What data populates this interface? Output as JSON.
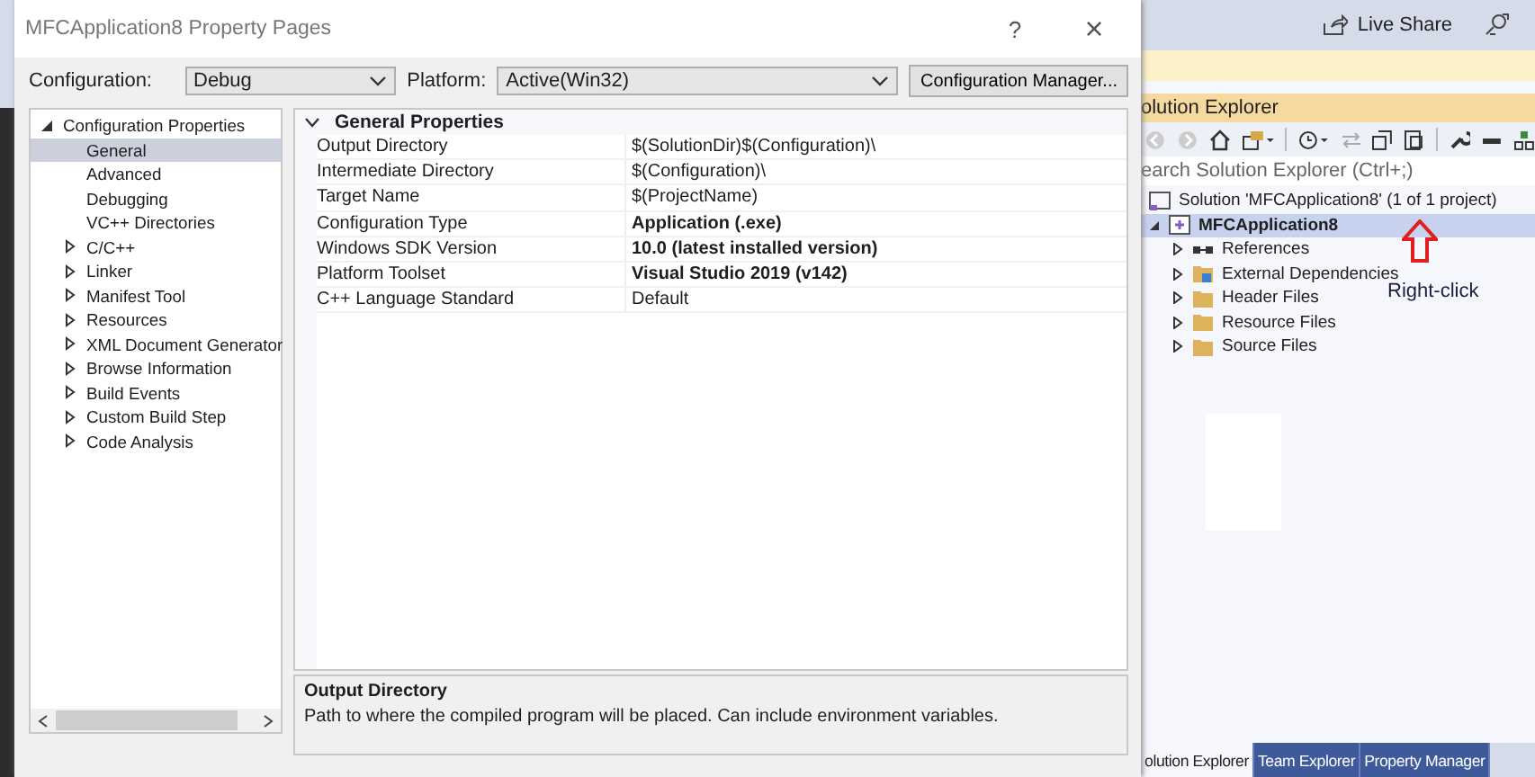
{
  "dialog": {
    "title": "MFCApplication8 Property Pages",
    "help": "?",
    "close": "×",
    "configuration": {
      "label": "Configuration:",
      "value": "Debug"
    },
    "platform": {
      "label": "Platform:",
      "value": "Active(Win32)"
    },
    "config_manager": "Configuration Manager...",
    "tree": [
      {
        "label": "Configuration Properties",
        "expanded": true,
        "selected": false,
        "children": [
          {
            "label": "General",
            "selected": true,
            "expandable": false
          },
          {
            "label": "Advanced",
            "selected": false,
            "expandable": false
          },
          {
            "label": "Debugging",
            "selected": false,
            "expandable": false
          },
          {
            "label": "VC++ Directories",
            "selected": false,
            "expandable": false
          },
          {
            "label": "C/C++",
            "selected": false,
            "expandable": true
          },
          {
            "label": "Linker",
            "selected": false,
            "expandable": true
          },
          {
            "label": "Manifest Tool",
            "selected": false,
            "expandable": true
          },
          {
            "label": "Resources",
            "selected": false,
            "expandable": true
          },
          {
            "label": "XML Document Generator",
            "selected": false,
            "expandable": true
          },
          {
            "label": "Browse Information",
            "selected": false,
            "expandable": true
          },
          {
            "label": "Build Events",
            "selected": false,
            "expandable": true
          },
          {
            "label": "Custom Build Step",
            "selected": false,
            "expandable": true
          },
          {
            "label": "Code Analysis",
            "selected": false,
            "expandable": true
          }
        ]
      }
    ],
    "section": {
      "title": "General Properties",
      "expanded": true,
      "rows": [
        {
          "name": "Output Directory",
          "value": "$(SolutionDir)$(Configuration)\\",
          "bold": false
        },
        {
          "name": "Intermediate Directory",
          "value": "$(Configuration)\\",
          "bold": false
        },
        {
          "name": "Target Name",
          "value": "$(ProjectName)",
          "bold": false
        },
        {
          "name": "Configuration Type",
          "value": "Application (.exe)",
          "bold": true
        },
        {
          "name": "Windows SDK Version",
          "value": "10.0 (latest installed version)",
          "bold": true
        },
        {
          "name": "Platform Toolset",
          "value": "Visual Studio 2019 (v142)",
          "bold": true
        },
        {
          "name": "C++ Language Standard",
          "value": "Default",
          "bold": false
        }
      ]
    },
    "description": {
      "title": "Output Directory",
      "text": "Path to where the compiled program will be placed. Can include environment variables."
    }
  },
  "ide": {
    "live_share": "Live Share",
    "solution_explorer": {
      "title": "olution Explorer",
      "search_placeholder": "earch Solution Explorer (Ctrl+;)",
      "items": [
        {
          "label": "Solution 'MFCApplication8' (1 of 1 project)",
          "kind": "solution",
          "selected": false
        },
        {
          "label": "MFCApplication8",
          "kind": "project",
          "selected": true,
          "expanded": true,
          "children": [
            {
              "label": "References",
              "kind": "references",
              "selected": false,
              "expanded": false
            },
            {
              "label": "External Dependencies",
              "kind": "dependencies",
              "selected": false,
              "expanded": false
            },
            {
              "label": "Header Files",
              "kind": "folder",
              "selected": false,
              "expanded": false
            },
            {
              "label": "Resource Files",
              "kind": "folder",
              "selected": false,
              "expanded": false
            },
            {
              "label": "Source Files",
              "kind": "folder",
              "selected": false,
              "expanded": false
            }
          ]
        }
      ],
      "annotation": "Right-click"
    },
    "tabs": [
      {
        "label": "olution Explorer",
        "selected": true
      },
      {
        "label": "Team Explorer",
        "selected": false
      },
      {
        "label": "Property Manager",
        "selected": false
      }
    ]
  }
}
